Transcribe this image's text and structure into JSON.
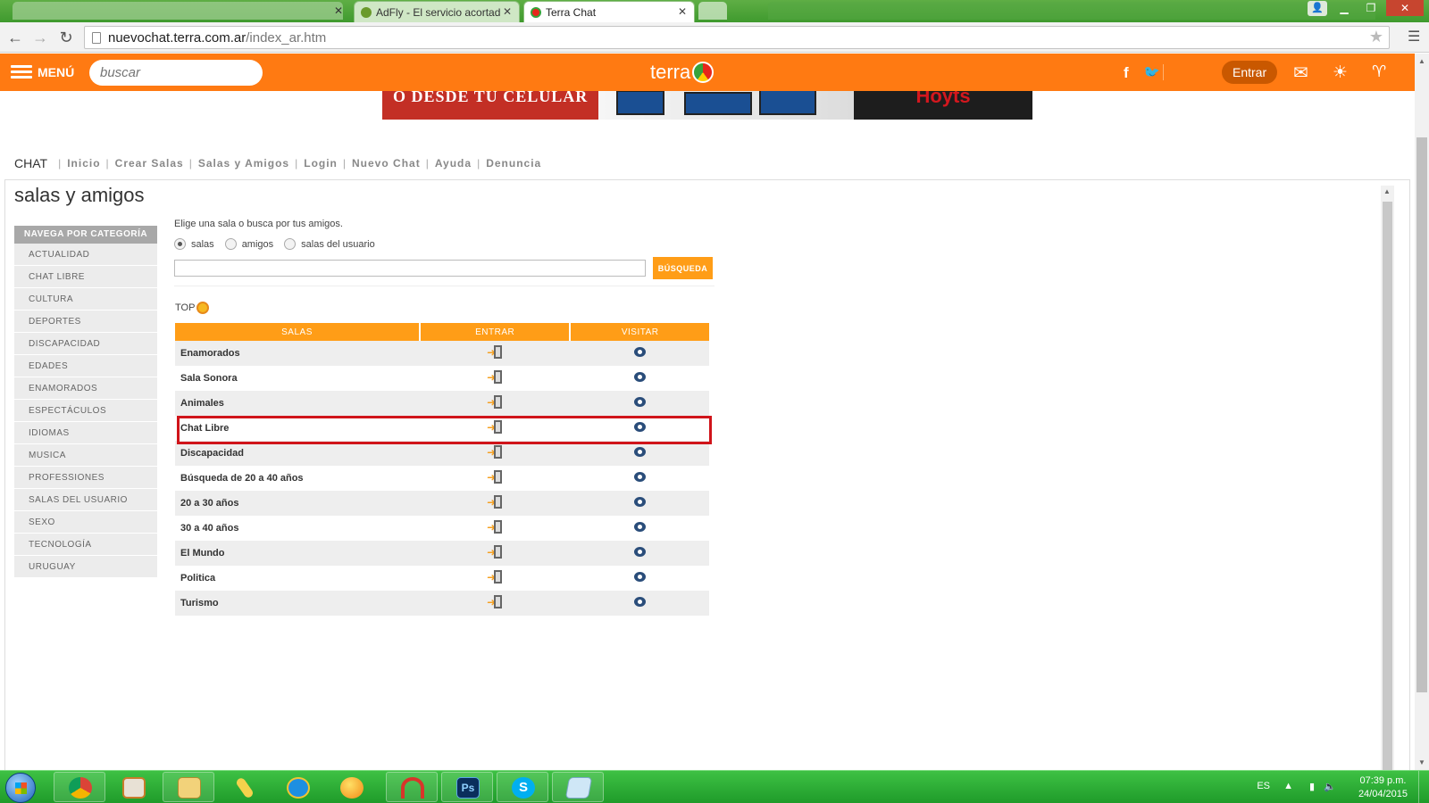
{
  "browser": {
    "tabs": [
      {
        "title": "AdFly - El servicio acortad",
        "favicon_color": "#6a9a2b"
      },
      {
        "title": "Terra Chat",
        "favicon_color": "#e7261b",
        "active": true
      }
    ],
    "url_host": "nuevochat.terra.com.ar",
    "url_path": "/index_ar.htm",
    "icons": {
      "back": "back-arrow-icon",
      "forward": "forward-arrow-icon",
      "reload": "reload-icon",
      "star": "bookmark-star-icon",
      "menu": "hamburger-menu-icon"
    }
  },
  "header": {
    "menu_label": "MENÚ",
    "search_placeholder": "buscar",
    "logo_text": "terra",
    "login_label": "Entrar",
    "accent": "#ff7a12"
  },
  "banner": {
    "left_text": "O DESDE TU CELULAR",
    "right_text": "Hoyts"
  },
  "chat_nav": {
    "brand": "CHAT",
    "links": [
      "Inicio",
      "Crear Salas",
      "Salas y Amigos",
      "Login",
      "Nuevo Chat",
      "Ayuda",
      "Denuncia"
    ]
  },
  "page_title": "salas y amigos",
  "sidebar": {
    "heading": "NAVEGA POR CATEGORÍA",
    "items": [
      "ACTUALIDAD",
      "CHAT LIBRE",
      "CULTURA",
      "DEPORTES",
      "DISCAPACIDAD",
      "EDADES",
      "ENAMORADOS",
      "ESPECTÁCULOS",
      "IDIOMAS",
      "MUSICA",
      "PROFESSIONES",
      "SALAS DEL USUARIO",
      "SEXO",
      "TECNOLOGÍA",
      "URUGUAY"
    ]
  },
  "search_area": {
    "intro": "Elige una sala o busca por tus amigos.",
    "radios": [
      {
        "label": "salas",
        "checked": true
      },
      {
        "label": "amigos",
        "checked": false
      },
      {
        "label": "salas del usuario",
        "checked": false
      }
    ],
    "input_value": "",
    "button_label": "BÚSQUEDA"
  },
  "top_label": "TOP",
  "rooms_table": {
    "headers": [
      "SALAS",
      "ENTRAR",
      "VISITAR"
    ],
    "rows": [
      {
        "name": "Enamorados"
      },
      {
        "name": "Sala Sonora"
      },
      {
        "name": "Animales"
      },
      {
        "name": "Chat Libre",
        "highlighted": true
      },
      {
        "name": "Discapacidad"
      },
      {
        "name": "Búsqueda de 20 a 40 años"
      },
      {
        "name": "20 a 30 años"
      },
      {
        "name": "30 a 40 años"
      },
      {
        "name": "El Mundo"
      },
      {
        "name": "Politica"
      },
      {
        "name": "Turismo"
      }
    ],
    "highlight_color": "#d0141a"
  },
  "taskbar": {
    "apps": [
      "chrome",
      "media-player",
      "file-explorer",
      "pencil-app",
      "internet-explorer",
      "orange-app",
      "arc-app",
      "photoshop",
      "skype",
      "notepad-app"
    ],
    "language": "ES",
    "time": "07:39 p.m.",
    "date": "24/04/2015"
  }
}
